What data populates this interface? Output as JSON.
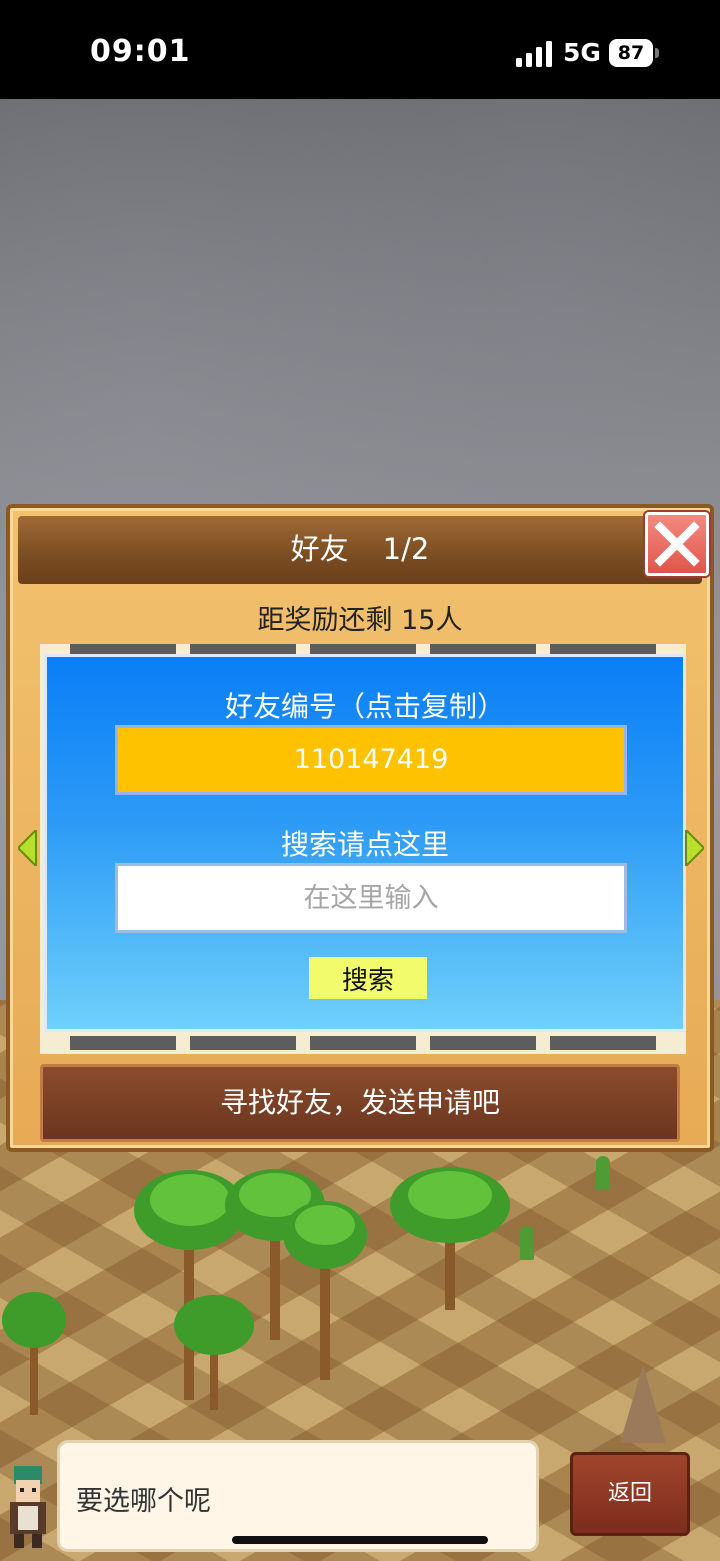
{
  "status_bar": {
    "time": "09:01",
    "network": "5G",
    "battery": "87"
  },
  "dialog": {
    "title": "好友",
    "page": "1/2",
    "reward_text": "距奖励还剩 15人",
    "friend_id_label": "好友编号（点击复制）",
    "friend_id_value": "110147419",
    "search_label": "搜索请点这里",
    "search_placeholder": "在这里输入",
    "search_button": "搜索",
    "send_request_button": "寻找好友，发送申请吧"
  },
  "bottom": {
    "speech_text": "要选哪个呢",
    "back_button": "返回"
  },
  "colors": {
    "panel_blue": "#0a7ef7",
    "friend_id_bg": "#ffc200",
    "search_button_bg": "#f2fb6b",
    "close_red": "#e0554b",
    "send_button_brown": "#7a4024"
  }
}
